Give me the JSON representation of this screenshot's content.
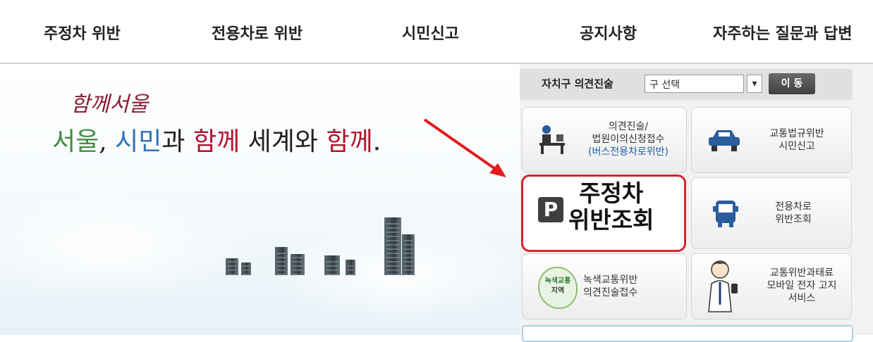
{
  "nav": {
    "items": [
      {
        "label": "주정차 위반"
      },
      {
        "label": "전용차로 위반"
      },
      {
        "label": "시민신고"
      },
      {
        "label": "공지사항"
      },
      {
        "label": "자주하는 질문과 답변"
      }
    ]
  },
  "hero": {
    "slogan_small": "함께서울",
    "slogan_parts": [
      "서울",
      ", ",
      "시민",
      "과 ",
      "함께",
      " 세계와 ",
      "함께",
      "."
    ]
  },
  "district": {
    "label": "자치구 의견진술",
    "select_value": "구 선택",
    "go_button": "이 동"
  },
  "cards": {
    "opinion": {
      "line1": "의견진술/",
      "line2": "법원이의신청접수",
      "line3": "(버스전용차로위반)"
    },
    "report": {
      "line1": "교통법규위반",
      "line2": "시민신고"
    },
    "parking": {
      "icon_letter": "P",
      "line1": "주정차",
      "line2": "위반조회"
    },
    "lane": {
      "line1": "전용차로",
      "line2": "위반조회"
    },
    "green": {
      "badge_top": "녹색교통",
      "badge_bottom": "지역",
      "line1": "녹색교통위반",
      "line2": "의견진술접수"
    },
    "mobile": {
      "line1": "교통위반과태료",
      "line2": "모바일 전자 고지",
      "line3": "서비스"
    }
  },
  "colors": {
    "accent_red": "#d8242b",
    "link_blue": "#1d5fa8",
    "slogan_green": "#3f8d3f",
    "slogan_blue": "#2f72b5",
    "slogan_red": "#b3142c"
  }
}
